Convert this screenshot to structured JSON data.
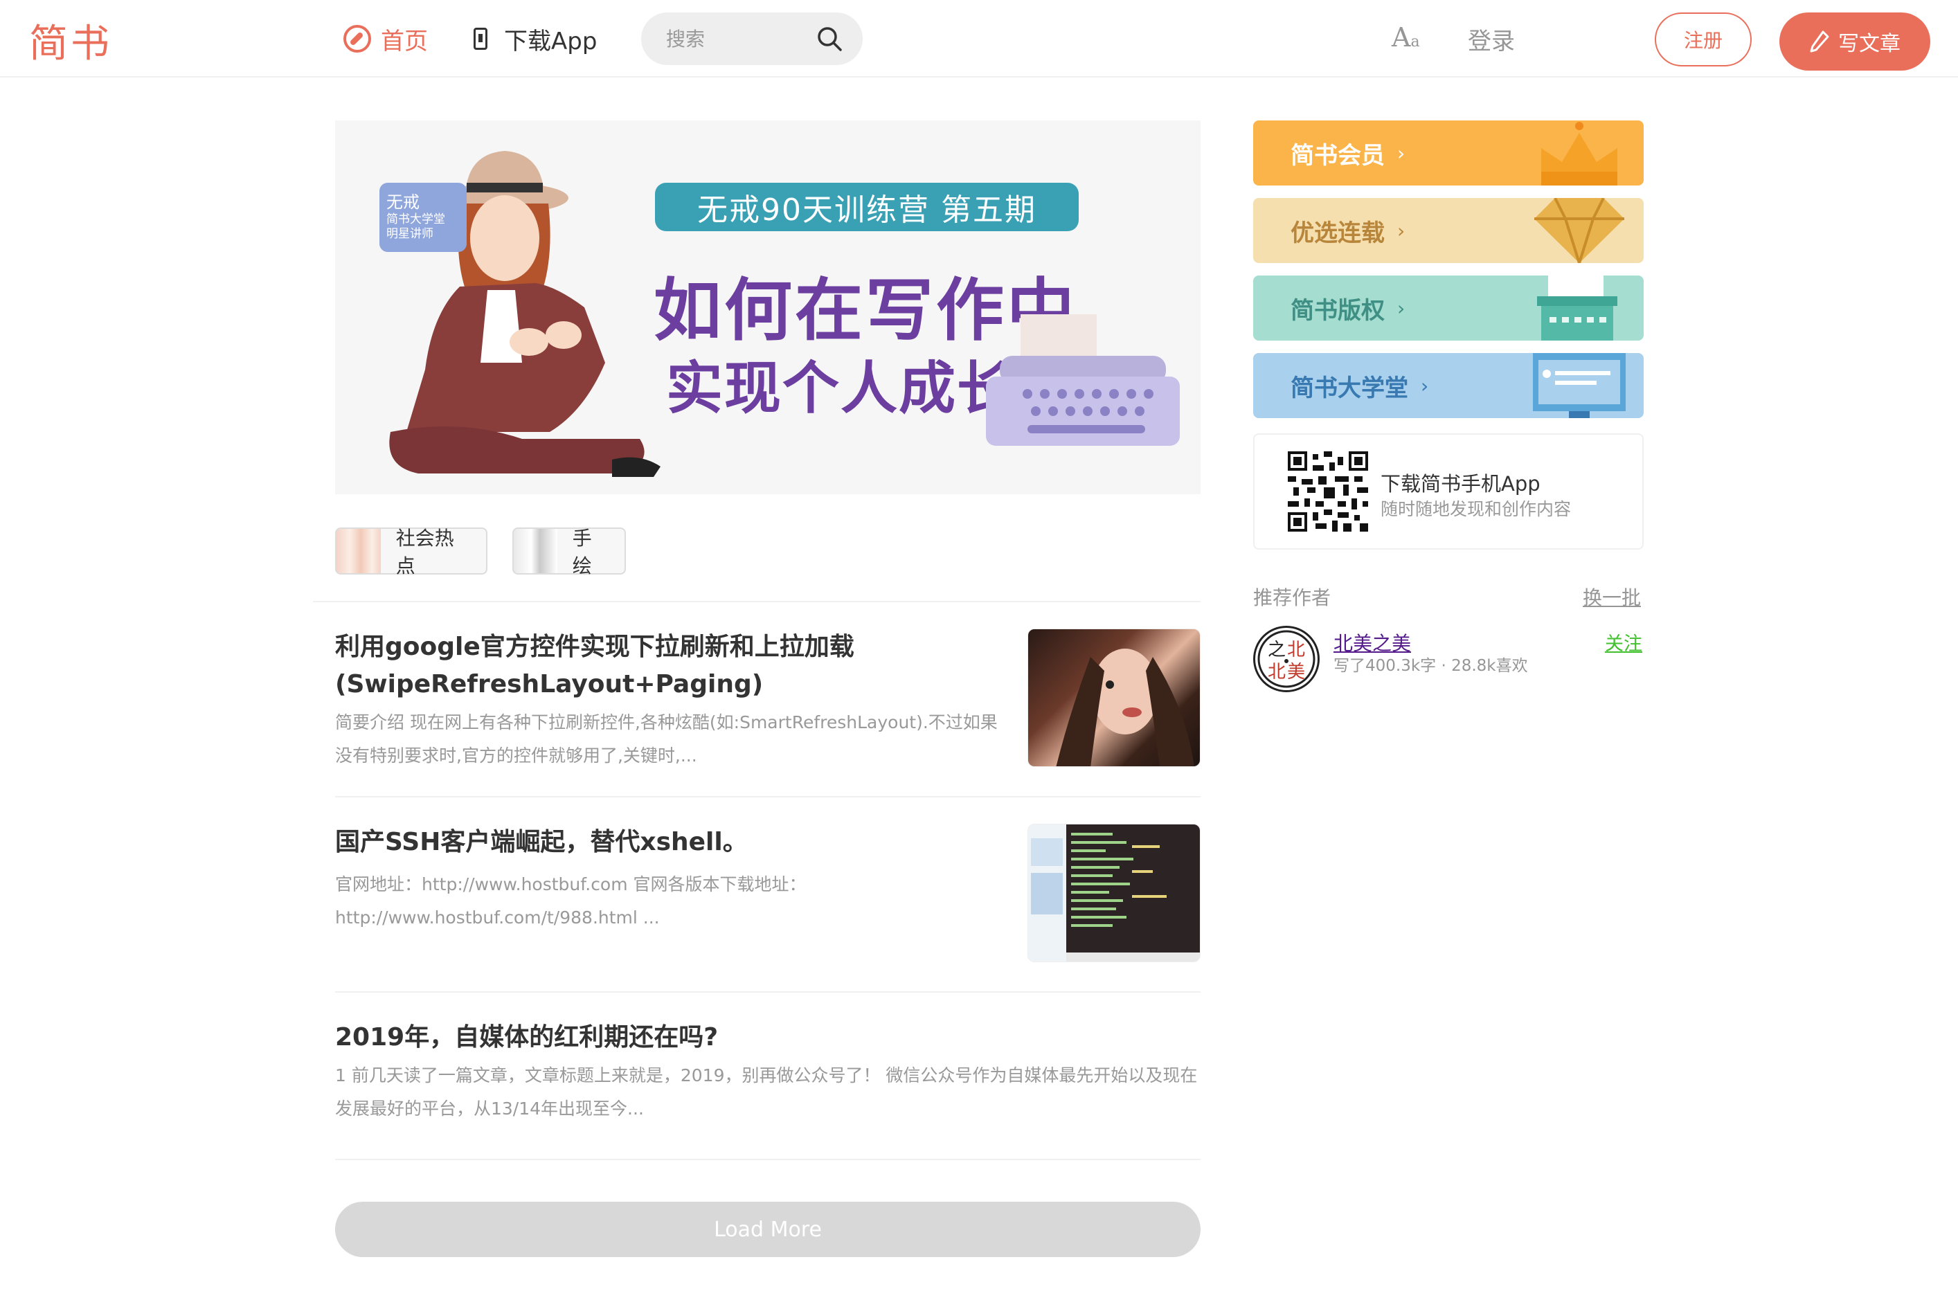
{
  "header": {
    "logo": "简书",
    "nav_home": "首页",
    "nav_app": "下载App",
    "search_placeholder": "搜索",
    "font_toggle_big": "A",
    "font_toggle_small": "a",
    "login": "登录",
    "register": "注册",
    "write": "写文章"
  },
  "banner": {
    "tag_name": "无戒",
    "tag_line1": "简书大学堂",
    "tag_line2": "明星讲师",
    "camp": "无戒90天训练营 第五期",
    "headline1": "如何在写作中",
    "headline2": "实现个人成长?"
  },
  "topics": [
    {
      "label": "社会热点"
    },
    {
      "label": "手绘"
    }
  ],
  "articles": [
    {
      "title": "利用google官方控件实现下拉刷新和上拉加载(SwipeRefreshLayout+Paging)",
      "abstract": "简要介绍 现在网上有各种下拉刷新控件,各种炫酷(如:SmartRefreshLayout).不过如果没有特别要求时,官方的控件就够用了,关键时,..."
    },
    {
      "title": "国产SSH客户端崛起，替代xshell。",
      "abstract": "官网地址：http://www.hostbuf.com 官网各版本下载地址：http://www.hostbuf.com/t/988.html ..."
    },
    {
      "title": "2019年，自媒体的红利期还在吗?",
      "abstract": "1 前几天读了一篇文章，文章标题上来就是，2019，别再做公众号了！ 微信公众号作为自媒体最先开始以及现在发展最好的平台，从13/14年出现至今..."
    }
  ],
  "load_more": "Load More",
  "sidebar": {
    "cards": [
      {
        "label": "简书会员",
        "bg": "#fbb449",
        "color": "#ffffff",
        "icon": "crown-icon"
      },
      {
        "label": "优选连载",
        "bg": "#f6dfae",
        "color": "#b8863b",
        "icon": "diamond-icon"
      },
      {
        "label": "简书版权",
        "bg": "#a5ddd0",
        "color": "#3f8f85",
        "icon": "typewriter-icon"
      },
      {
        "label": "简书大学堂",
        "bg": "#a9d0ec",
        "color": "#3779b0",
        "icon": "screen-icon"
      }
    ],
    "app_title": "下载简书手机App",
    "app_sub": "随时随地发现和创作内容",
    "rec_title": "推荐作者",
    "rec_refresh": "换一批",
    "author": {
      "name": "北美之美",
      "meta": "写了400.3k字 · 28.8k喜欢",
      "follow": "关注"
    }
  },
  "colors": {
    "brand": "#ea6f5a",
    "follow": "#42c02e"
  }
}
